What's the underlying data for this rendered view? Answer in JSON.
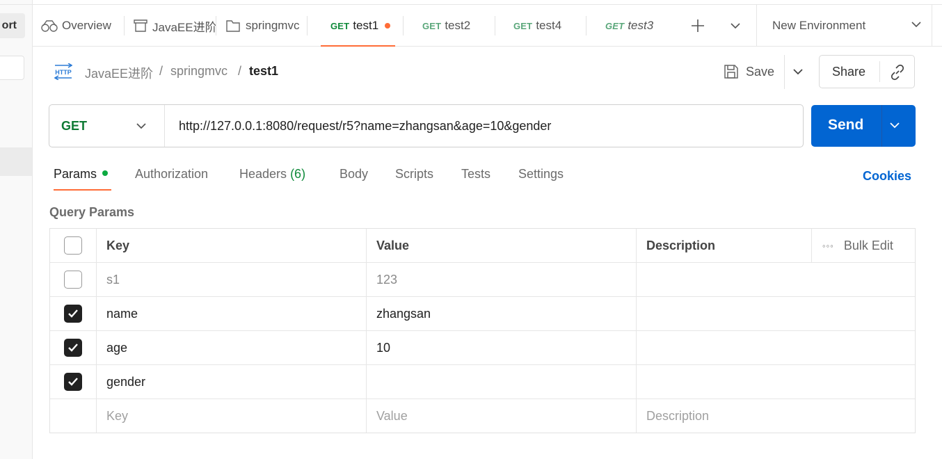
{
  "left_panel": {
    "import_label": "ort"
  },
  "tabs": [
    {
      "label": "Overview",
      "type": "overview"
    },
    {
      "label": "JavaEE进阶",
      "type": "collection"
    },
    {
      "label": "springmvc",
      "type": "folder"
    },
    {
      "method": "GET",
      "label": "test1",
      "active": true,
      "unsaved": true
    },
    {
      "method": "GET",
      "label": "test2"
    },
    {
      "method": "GET",
      "label": "test4"
    },
    {
      "method": "GET",
      "label": "test3",
      "italic": true
    }
  ],
  "environment": {
    "label": "New Environment"
  },
  "breadcrumb": {
    "collection": "JavaEE进阶",
    "separator": "/",
    "folder": "springmvc",
    "request": "test1"
  },
  "actions": {
    "save": "Save",
    "share": "Share"
  },
  "request": {
    "method": "GET",
    "url": "http://127.0.0.1:8080/request/r5?name=zhangsan&age=10&gender",
    "send": "Send"
  },
  "subtabs": {
    "params": "Params",
    "authorization": "Authorization",
    "headers": "Headers",
    "headers_count": "(6)",
    "body": "Body",
    "scripts": "Scripts",
    "tests": "Tests",
    "settings": "Settings",
    "cookies": "Cookies"
  },
  "query_params": {
    "title": "Query Params",
    "headers": {
      "key": "Key",
      "value": "Value",
      "description": "Description",
      "bulk_edit": "Bulk Edit"
    },
    "rows": [
      {
        "key": "s1",
        "value": "123",
        "description": "",
        "checked": false
      },
      {
        "key": "name",
        "value": "zhangsan",
        "description": "",
        "checked": true
      },
      {
        "key": "age",
        "value": "10",
        "description": "",
        "checked": true
      },
      {
        "key": "gender",
        "value": "",
        "description": "",
        "checked": true
      }
    ],
    "placeholders": {
      "key": "Key",
      "value": "Value",
      "description": "Description"
    }
  },
  "colors": {
    "accent": "#ff6c37",
    "primary": "#0265d2",
    "get": "#0f8a3a"
  }
}
